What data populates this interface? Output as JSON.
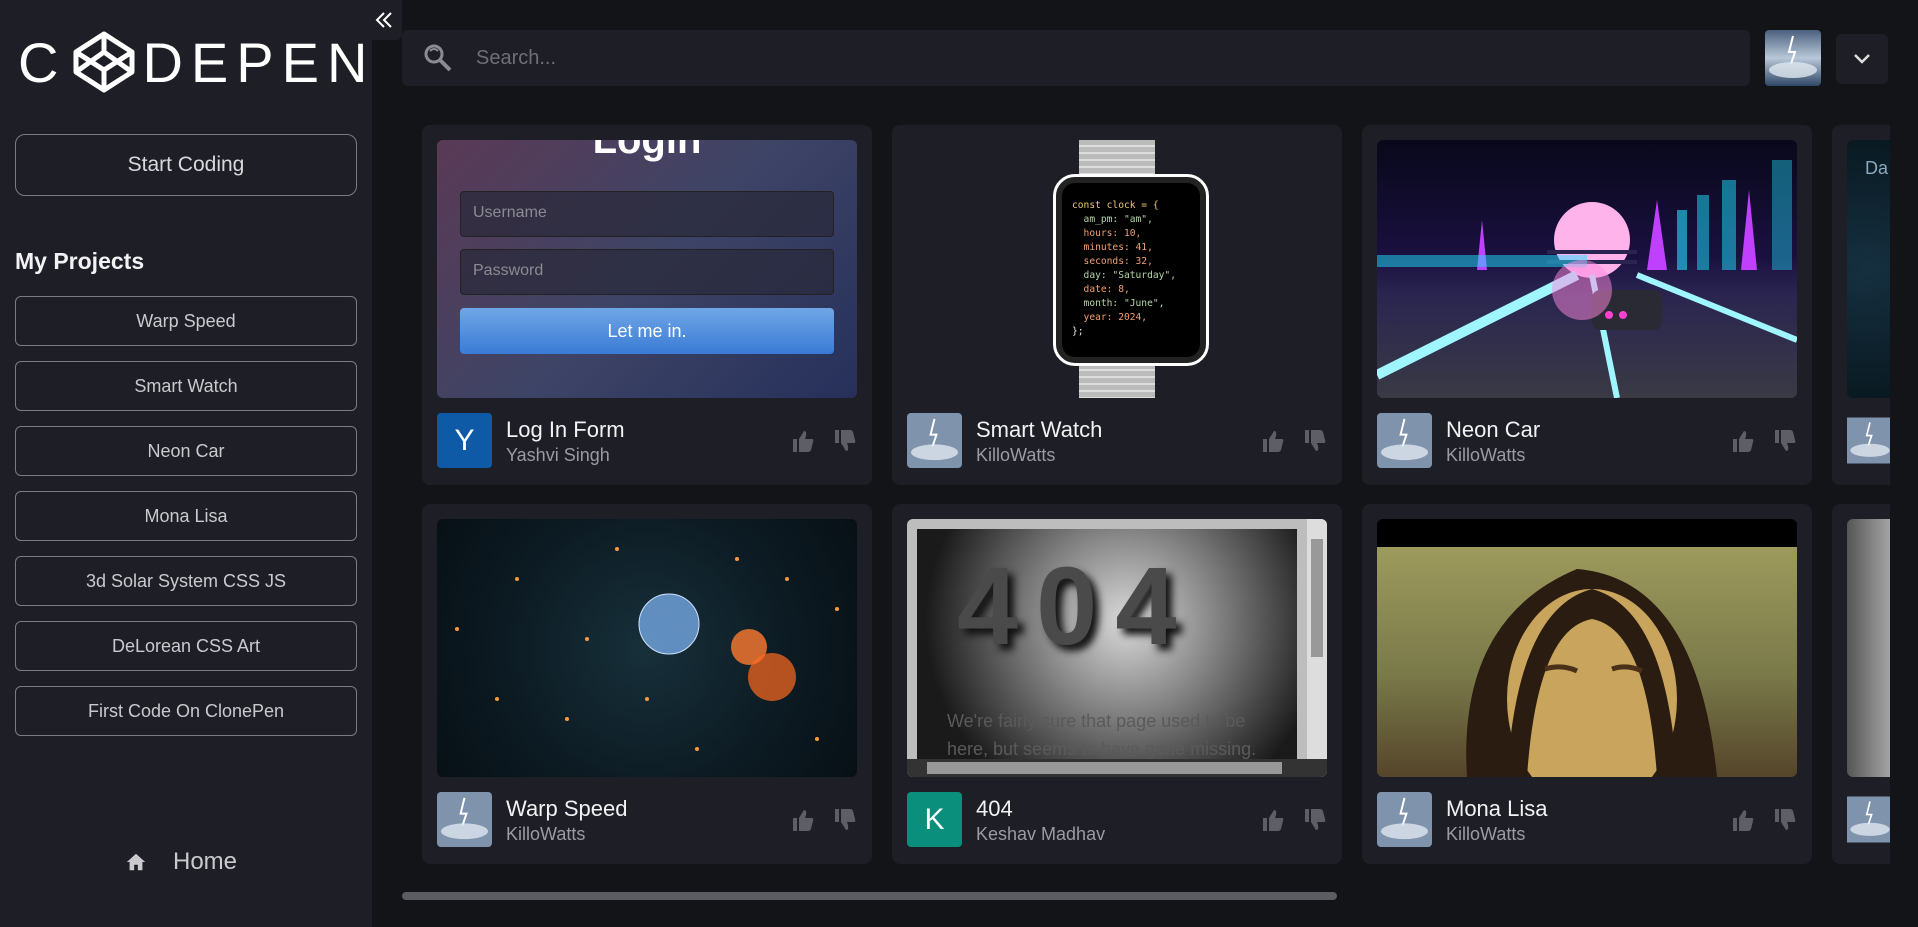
{
  "app": {
    "logo_text": "DEPEN",
    "logo_prefix": "C"
  },
  "sidebar": {
    "start_label": "Start Coding",
    "projects_heading": "My Projects",
    "projects": [
      {
        "label": "Warp Speed"
      },
      {
        "label": "Smart Watch"
      },
      {
        "label": "Neon Car"
      },
      {
        "label": "Mona Lisa"
      },
      {
        "label": "3d Solar System CSS JS"
      },
      {
        "label": "DeLorean CSS Art"
      },
      {
        "label": "First Code On ClonePen"
      }
    ],
    "home_label": "Home"
  },
  "search": {
    "placeholder": "Search..."
  },
  "cards": [
    {
      "title": "Log In Form",
      "author": "Yashvi Singh",
      "avatar_letter": "Y",
      "avatar_color": "#0e5aa7"
    },
    {
      "title": "Smart Watch",
      "author": "KilloWatts"
    },
    {
      "title": "Neon Car",
      "author": "KilloWatts"
    },
    {
      "title": "Warp Speed",
      "author": "KilloWatts"
    },
    {
      "title": "404",
      "author": "Keshav Madhav",
      "avatar_letter": "K",
      "avatar_color": "#0a8f7d"
    },
    {
      "title": "Mona Lisa",
      "author": "KilloWatts"
    }
  ],
  "login_preview": {
    "heading": "Login",
    "username_placeholder": "Username",
    "password_placeholder": "Password",
    "submit": "Let me in."
  },
  "watch_preview": {
    "code": [
      "const clock = {",
      "  am_pm: \"am\",",
      "  hours: 10,",
      "  minutes: 41,",
      "  seconds: 32,",
      "  day: \"Saturday\",",
      "  date: 8,",
      "  month: \"June\",",
      "  year: 2024,",
      "};"
    ]
  },
  "error_preview": {
    "code": "404",
    "message_line1": "We're fairly sure that page used to be",
    "message_line2": "here, but seems to have gone missing."
  },
  "partial_card": {
    "text": "Da"
  },
  "colors": {
    "background": "#131417",
    "panel": "#1e1f26",
    "border": "#7a7b85"
  }
}
